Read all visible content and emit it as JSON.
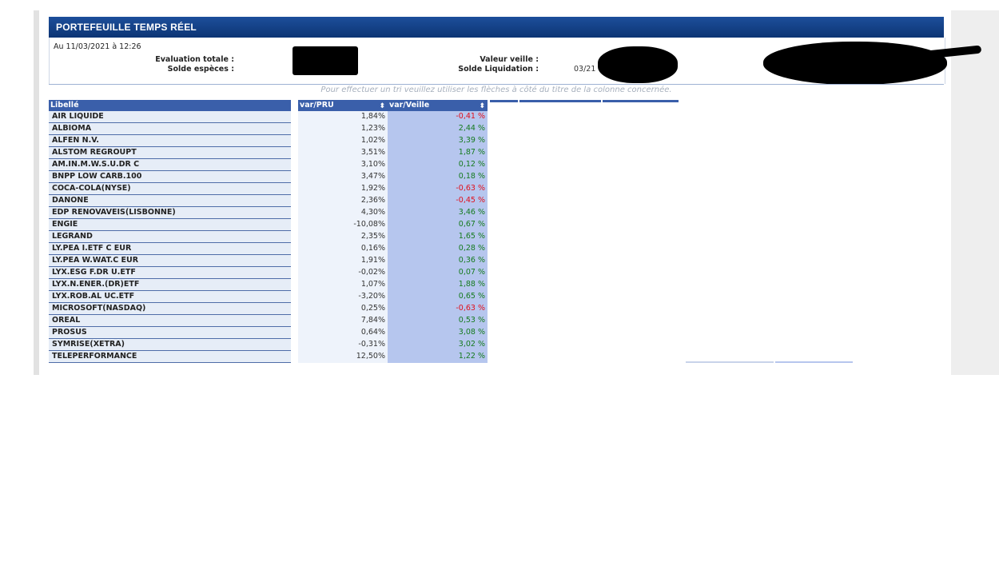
{
  "panel_title": "PORTEFEUILLE TEMPS RÉEL",
  "date_text": "Au 11/03/2021 à 12:26",
  "labels": {
    "evaluation_totale": "Evaluation totale :",
    "solde_especes": "Solde espèces :",
    "valeur_veille": "Valeur veille :",
    "solde_liquidation": "Solde Liquidation :",
    "liquidation_date_partial": "03/21"
  },
  "hint": "Pour effectuer un tri veuillez utiliser les flèches à côté du titre de la colonne concernée.",
  "columns": {
    "libelle": "Libellé",
    "var_pru": "var/PRU",
    "var_veille": "var/Veille",
    "sort_icon": "sort-arrows-icon"
  },
  "rows": [
    {
      "libelle": "AIR LIQUIDE",
      "var_pru": "1,84%",
      "var_veille": "-0,41 %",
      "trend": "neg"
    },
    {
      "libelle": "ALBIOMA",
      "var_pru": "1,23%",
      "var_veille": "2,44 %",
      "trend": "pos"
    },
    {
      "libelle": "ALFEN N.V.",
      "var_pru": "1,02%",
      "var_veille": "3,39 %",
      "trend": "pos"
    },
    {
      "libelle": "ALSTOM REGROUPT",
      "var_pru": "3,51%",
      "var_veille": "1,87 %",
      "trend": "pos"
    },
    {
      "libelle": "AM.IN.M.W.S.U.DR C",
      "var_pru": "3,10%",
      "var_veille": "0,12 %",
      "trend": "pos"
    },
    {
      "libelle": "BNPP LOW CARB.100",
      "var_pru": "3,47%",
      "var_veille": "0,18 %",
      "trend": "pos"
    },
    {
      "libelle": "COCA-COLA(NYSE)",
      "var_pru": "1,92%",
      "var_veille": "-0,63 %",
      "trend": "neg"
    },
    {
      "libelle": "DANONE",
      "var_pru": "2,36%",
      "var_veille": "-0,45 %",
      "trend": "neg"
    },
    {
      "libelle": "EDP RENOVAVEIS(LISBONNE)",
      "var_pru": "4,30%",
      "var_veille": "3,46 %",
      "trend": "pos"
    },
    {
      "libelle": "ENGIE",
      "var_pru": "-10,08%",
      "var_veille": "0,67 %",
      "trend": "pos"
    },
    {
      "libelle": "LEGRAND",
      "var_pru": "2,35%",
      "var_veille": "1,65 %",
      "trend": "pos"
    },
    {
      "libelle": "LY.PEA I.ETF C EUR",
      "var_pru": "0,16%",
      "var_veille": "0,28 %",
      "trend": "pos"
    },
    {
      "libelle": "LY.PEA W.WAT.C EUR",
      "var_pru": "1,91%",
      "var_veille": "0,36 %",
      "trend": "pos"
    },
    {
      "libelle": "LYX.ESG F.DR U.ETF",
      "var_pru": "-0,02%",
      "var_veille": "0,07 %",
      "trend": "pos"
    },
    {
      "libelle": "LYX.N.ENER.(DR)ETF",
      "var_pru": "1,07%",
      "var_veille": "1,88 %",
      "trend": "pos"
    },
    {
      "libelle": "LYX.ROB.AL UC.ETF",
      "var_pru": "-3,20%",
      "var_veille": "0,65 %",
      "trend": "pos"
    },
    {
      "libelle": "MICROSOFT(NASDAQ)",
      "var_pru": "0,25%",
      "var_veille": "-0,63 %",
      "trend": "neg"
    },
    {
      "libelle": "OREAL",
      "var_pru": "7,84%",
      "var_veille": "0,53 %",
      "trend": "pos"
    },
    {
      "libelle": "PROSUS",
      "var_pru": "0,64%",
      "var_veille": "3,08 %",
      "trend": "pos"
    },
    {
      "libelle": "SYMRISE(XETRA)",
      "var_pru": "-0,31%",
      "var_veille": "3,02 %",
      "trend": "pos"
    },
    {
      "libelle": "TELEPERFORMANCE",
      "var_pru": "12,50%",
      "var_veille": "1,22 %",
      "trend": "pos"
    }
  ],
  "colors": {
    "title_bar": "#0c3574",
    "header": "#3a5faa",
    "positive": "#157a1e",
    "negative": "#e0101c",
    "veille_bg": "#b6c6ee"
  }
}
